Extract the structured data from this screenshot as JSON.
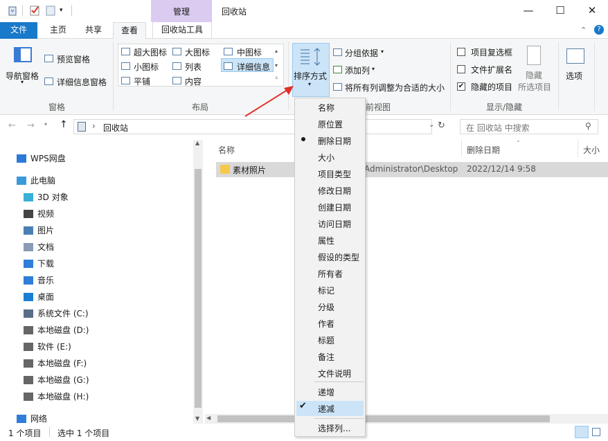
{
  "window": {
    "title": "回收站",
    "manage_tab": "管理",
    "minimize": "—",
    "maximize": "☐",
    "close": "✕"
  },
  "tabs": {
    "file": "文件",
    "home": "主页",
    "share": "共享",
    "view": "查看",
    "recycle_tools": "回收站工具"
  },
  "ribbon": {
    "pane": {
      "nav_pane": "导航窗格",
      "preview_pane": "预览窗格",
      "details_pane": "详细信息窗格",
      "group": "窗格"
    },
    "layout": {
      "items": [
        "超大图标",
        "大图标",
        "中图标",
        "小图标",
        "列表",
        "详细信息",
        "平铺",
        "内容"
      ],
      "group": "布局"
    },
    "current_view": {
      "sort_by": "排序方式",
      "group_by": "分组依据",
      "add_column": "添加列",
      "fit_columns": "将所有列调整为合适的大小",
      "group_partial": "前视图"
    },
    "show_hide": {
      "item_checkbox": "项目复选框",
      "extensions": "文件扩展名",
      "hidden_items": "隐藏的项目",
      "hide_selected_1": "隐藏",
      "hide_selected_2": "所选项目",
      "group": "显示/隐藏"
    },
    "options": "选项"
  },
  "address": {
    "crumb": "回收站",
    "search_placeholder": "在 回收站 中搜索"
  },
  "nav": {
    "items": [
      {
        "label": "WPS网盘",
        "icon": "cloud-icon"
      },
      {
        "label": "此电脑",
        "icon": "computer-icon"
      },
      {
        "label": "3D 对象",
        "icon": "cube-icon"
      },
      {
        "label": "视频",
        "icon": "video-icon"
      },
      {
        "label": "图片",
        "icon": "picture-icon"
      },
      {
        "label": "文档",
        "icon": "document-icon"
      },
      {
        "label": "下载",
        "icon": "download-icon"
      },
      {
        "label": "音乐",
        "icon": "music-icon"
      },
      {
        "label": "桌面",
        "icon": "desktop-icon"
      },
      {
        "label": "系统文件 (C:)",
        "icon": "system-drive-icon"
      },
      {
        "label": "本地磁盘 (D:)",
        "icon": "drive-icon"
      },
      {
        "label": "软件 (E:)",
        "icon": "drive-icon"
      },
      {
        "label": "本地磁盘 (F:)",
        "icon": "drive-icon"
      },
      {
        "label": "本地磁盘 (G:)",
        "icon": "drive-icon"
      },
      {
        "label": "本地磁盘 (H:)",
        "icon": "drive-icon"
      },
      {
        "label": "网络",
        "icon": "network-icon"
      }
    ]
  },
  "content": {
    "columns": {
      "name": "名称",
      "deleted_date": "删除日期",
      "size": "大小"
    },
    "rows": [
      {
        "name": "素材照片",
        "original_location": "Administrator\\Desktop",
        "deleted_date": "2022/12/14 9:58"
      }
    ]
  },
  "sort_menu": {
    "items": [
      "名称",
      "原位置",
      "删除日期",
      "大小",
      "项目类型",
      "修改日期",
      "创建日期",
      "访问日期",
      "属性",
      "假设的类型",
      "所有者",
      "标记",
      "分级",
      "作者",
      "标题",
      "备注",
      "文件说明"
    ],
    "selected": "删除日期",
    "ascending": "递增",
    "descending": "递减",
    "order_selected": "递减",
    "choose_columns": "选择列..."
  },
  "status": {
    "count": "1 个项目",
    "selected": "选中 1 个项目"
  },
  "colors": {
    "accent": "#1979ca",
    "manage": "#dccbf0",
    "selection": "#cce4f7",
    "arrow": "#e0302a"
  }
}
